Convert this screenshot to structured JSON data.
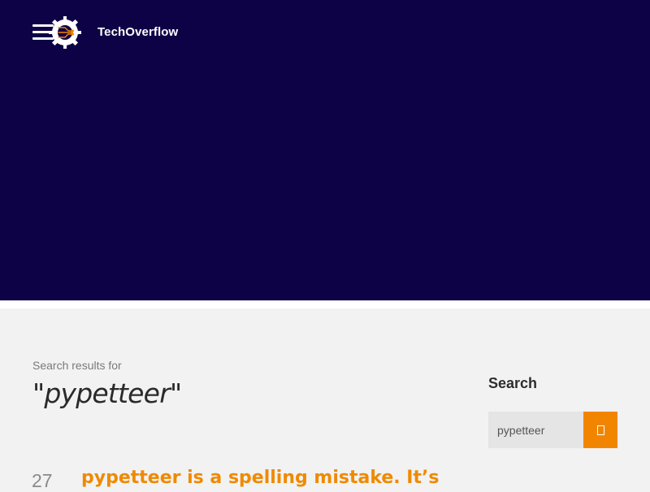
{
  "site": {
    "brand": "TechOverflow"
  },
  "search": {
    "results_label": "Search results for",
    "query": "\"pypetteer\""
  },
  "sidebar": {
    "title": "Search",
    "input_value": "pypetteer",
    "button_icon": "search-glyph"
  },
  "post": {
    "date_day": "27",
    "title": "pypetteer is a spelling mistake. It’s"
  },
  "colors": {
    "hero": "#0e0246",
    "accent": "#f28500",
    "page_bg": "#f2f2f2"
  }
}
